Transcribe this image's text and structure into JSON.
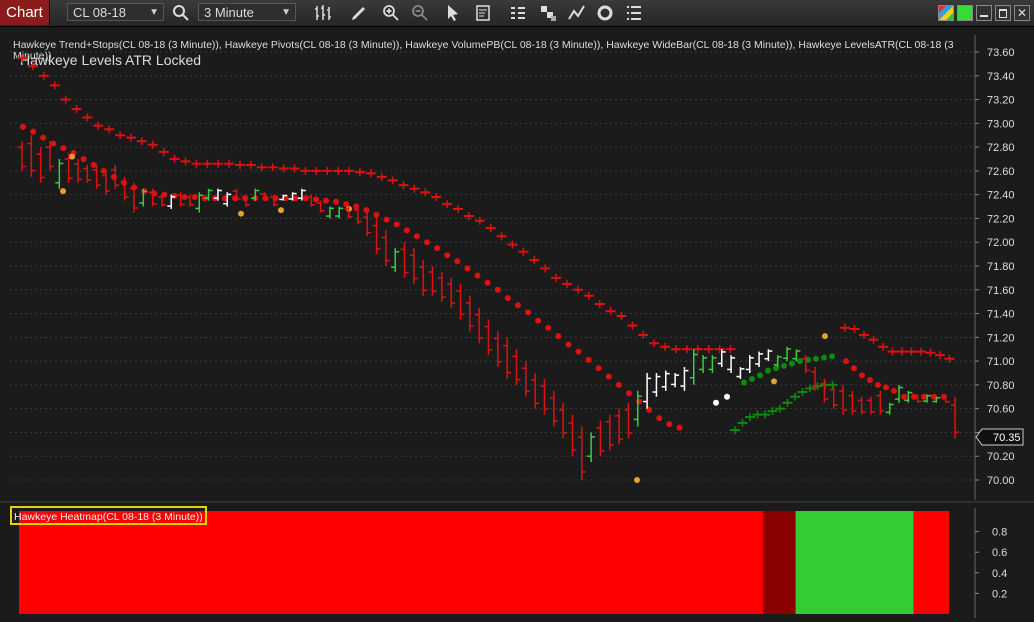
{
  "toolbar": {
    "chart_label": "Chart",
    "instrument": "CL 08-18",
    "interval": "3 Minute"
  },
  "colors": {
    "bear": "#e01010",
    "bull": "#3ccc3c",
    "neutral": "#ffffff",
    "pivot": "#e8a030",
    "stop_bull": "#0c8a0c",
    "heat_dark": "#8b0000"
  },
  "chart": {
    "indicators_line": "Hawkeye Trend+Stops(CL 08-18 (3 Minute)), Hawkeye Pivots(CL 08-18 (3 Minute)), Hawkeye VolumePB(CL 08-18 (3 Minute)), Hawkeye WideBar(CL 08-18 (3 Minute)), Hawkeye LevelsATR(CL 08-18 (3",
    "indicators_wrap": "Minute))",
    "levels_label": "Hawkeye Levels ATR Locked",
    "price_axis": [
      "73.60",
      "73.40",
      "73.20",
      "73.00",
      "72.80",
      "72.60",
      "72.40",
      "72.20",
      "72.00",
      "71.80",
      "71.60",
      "71.40",
      "71.20",
      "71.00",
      "70.80",
      "70.60",
      "70.40",
      "70.20",
      "70.00"
    ],
    "last_price": "70.35",
    "heatmap_label": "Hawkeye Heatmap(CL 08-18 (3 Minute))",
    "heatmap_axis": [
      "0.8",
      "0.6",
      "0.4",
      "0.2"
    ]
  },
  "chart_data": {
    "type": "ohlc",
    "price_range": [
      69.85,
      73.75
    ],
    "bars": [
      [
        72.85,
        72.6,
        "r"
      ],
      [
        72.9,
        72.55,
        "r"
      ],
      [
        72.8,
        72.5,
        "r"
      ],
      [
        72.85,
        72.6,
        "r"
      ],
      [
        72.7,
        72.45,
        "g"
      ],
      [
        72.75,
        72.5,
        "r"
      ],
      [
        72.7,
        72.5,
        "r"
      ],
      [
        72.65,
        72.5,
        "r"
      ],
      [
        72.65,
        72.45,
        "r"
      ],
      [
        72.6,
        72.4,
        "r"
      ],
      [
        72.65,
        72.45,
        "r"
      ],
      [
        72.55,
        72.35,
        "r"
      ],
      [
        72.5,
        72.25,
        "r"
      ],
      [
        72.45,
        72.3,
        "g"
      ],
      [
        72.45,
        72.3,
        "r"
      ],
      [
        72.4,
        72.3,
        "r"
      ],
      [
        72.4,
        72.28,
        "w"
      ],
      [
        72.42,
        72.3,
        "r"
      ],
      [
        72.4,
        72.3,
        "r"
      ],
      [
        72.42,
        72.25,
        "g"
      ],
      [
        72.45,
        72.35,
        "g"
      ],
      [
        72.45,
        72.35,
        "w"
      ],
      [
        72.42,
        72.3,
        "w"
      ],
      [
        72.45,
        72.35,
        "r"
      ],
      [
        72.4,
        72.3,
        "r"
      ],
      [
        72.45,
        72.35,
        "g"
      ],
      [
        72.42,
        72.35,
        "r"
      ],
      [
        72.4,
        72.3,
        "r"
      ],
      [
        72.4,
        72.35,
        "w"
      ],
      [
        72.42,
        72.35,
        "w"
      ],
      [
        72.45,
        72.35,
        "w"
      ],
      [
        72.4,
        72.3,
        "r"
      ],
      [
        72.35,
        72.25,
        "r"
      ],
      [
        72.3,
        72.2,
        "g"
      ],
      [
        72.3,
        72.2,
        "g"
      ],
      [
        72.3,
        72.2,
        "r"
      ],
      [
        72.3,
        72.15,
        "r"
      ],
      [
        72.25,
        72.05,
        "r"
      ],
      [
        72.2,
        71.9,
        "r"
      ],
      [
        72.1,
        71.8,
        "r"
      ],
      [
        71.95,
        71.75,
        "g"
      ],
      [
        72.0,
        71.7,
        "r"
      ],
      [
        71.95,
        71.65,
        "r"
      ],
      [
        71.85,
        71.55,
        "r"
      ],
      [
        71.8,
        71.55,
        "r"
      ],
      [
        71.75,
        71.5,
        "r"
      ],
      [
        71.7,
        71.45,
        "r"
      ],
      [
        71.65,
        71.35,
        "r"
      ],
      [
        71.55,
        71.25,
        "r"
      ],
      [
        71.45,
        71.15,
        "r"
      ],
      [
        71.35,
        71.05,
        "r"
      ],
      [
        71.25,
        70.95,
        "r"
      ],
      [
        71.2,
        70.85,
        "r"
      ],
      [
        71.1,
        70.8,
        "r"
      ],
      [
        71.0,
        70.7,
        "r"
      ],
      [
        70.9,
        70.6,
        "r"
      ],
      [
        70.85,
        70.55,
        "r"
      ],
      [
        70.75,
        70.45,
        "r"
      ],
      [
        70.65,
        70.35,
        "r"
      ],
      [
        70.55,
        70.2,
        "r"
      ],
      [
        70.45,
        70.0,
        "r"
      ],
      [
        70.4,
        70.15,
        "g"
      ],
      [
        70.5,
        70.2,
        "r"
      ],
      [
        70.55,
        70.25,
        "r"
      ],
      [
        70.6,
        70.3,
        "r"
      ],
      [
        70.65,
        70.35,
        "r"
      ],
      [
        70.75,
        70.45,
        "g"
      ],
      [
        70.9,
        70.6,
        "w"
      ],
      [
        70.9,
        70.7,
        "w"
      ],
      [
        70.92,
        70.75,
        "w"
      ],
      [
        70.9,
        70.78,
        "w"
      ],
      [
        70.95,
        70.75,
        "w"
      ],
      [
        71.1,
        70.8,
        "g"
      ],
      [
        71.05,
        70.9,
        "g"
      ],
      [
        71.05,
        70.9,
        "g"
      ],
      [
        71.1,
        70.95,
        "w"
      ],
      [
        71.05,
        70.9,
        "w"
      ],
      [
        70.95,
        70.85,
        "w"
      ],
      [
        71.05,
        70.9,
        "w"
      ],
      [
        71.08,
        70.95,
        "w"
      ],
      [
        71.1,
        71.0,
        "w"
      ],
      [
        71.05,
        70.95,
        "g"
      ],
      [
        71.12,
        71.0,
        "g"
      ],
      [
        71.1,
        71.0,
        "g"
      ],
      [
        71.05,
        70.9,
        "r"
      ],
      [
        70.95,
        70.75,
        "r"
      ],
      [
        70.85,
        70.65,
        "r"
      ],
      [
        70.8,
        70.6,
        "r"
      ],
      [
        70.8,
        70.55,
        "r"
      ],
      [
        70.75,
        70.55,
        "r"
      ],
      [
        70.7,
        70.55,
        "r"
      ],
      [
        70.7,
        70.55,
        "r"
      ],
      [
        70.75,
        70.55,
        "r"
      ],
      [
        70.65,
        70.55,
        "g"
      ],
      [
        70.8,
        70.65,
        "g"
      ],
      [
        70.75,
        70.65,
        "g"
      ],
      [
        70.72,
        70.65,
        "r"
      ],
      [
        70.72,
        70.65,
        "g"
      ],
      [
        70.7,
        70.65,
        "g"
      ],
      [
        70.7,
        70.65,
        "r"
      ],
      [
        70.7,
        70.35,
        "r"
      ]
    ],
    "trend_dots_bear_y": [
      72.97,
      72.93,
      72.88,
      72.83,
      72.79,
      72.75,
      72.7,
      72.65,
      72.6,
      72.55,
      72.5,
      72.46,
      72.43,
      72.41,
      72.4,
      72.39,
      72.38,
      72.38,
      72.37,
      72.37,
      72.37,
      72.37,
      72.37,
      72.37,
      72.37,
      72.37,
      72.37,
      72.37,
      72.37,
      72.36,
      72.35,
      72.34,
      72.32,
      72.3,
      72.27,
      72.23,
      72.19,
      72.15,
      72.1,
      72.05,
      72.0,
      71.95,
      71.89,
      71.84,
      71.78,
      71.72,
      71.66,
      71.6,
      71.53,
      71.47,
      71.41,
      71.34,
      71.28,
      71.21,
      71.14,
      71.08,
      71.01,
      70.94,
      70.87,
      70.8,
      70.73,
      70.66,
      70.59,
      70.52,
      70.47,
      70.44
    ],
    "stop_line_bear_y": [
      73.55,
      73.48,
      73.4,
      73.32,
      73.2,
      73.12,
      73.05,
      72.98,
      72.95,
      72.9,
      72.88,
      72.85,
      72.82,
      72.76,
      72.7,
      72.68,
      72.66,
      72.66,
      72.66,
      72.66,
      72.65,
      72.65,
      72.63,
      72.63,
      72.62,
      72.62,
      72.6,
      72.6,
      72.6,
      72.6,
      72.6,
      72.59,
      72.58,
      72.55,
      72.52,
      72.48,
      72.45,
      72.42,
      72.38,
      72.32,
      72.28,
      72.22,
      72.18,
      72.12,
      72.05,
      71.98,
      71.92,
      71.85,
      71.78,
      71.7,
      71.65,
      71.6,
      71.55,
      71.48,
      71.42,
      71.38,
      71.3,
      71.22,
      71.15,
      71.12,
      71.1,
      71.1,
      71.1,
      71.1,
      71.1,
      71.1
    ],
    "heatmap": [
      {
        "value": 1.0,
        "color": "#ff0000",
        "start": 0,
        "end": 0.8
      },
      {
        "value": 1.0,
        "color": "#8b0000",
        "start": 0.8,
        "end": 0.835
      },
      {
        "value": 1.0,
        "color": "#33cc33",
        "start": 0.835,
        "end": 0.962
      },
      {
        "value": 1.0,
        "color": "#ff0000",
        "start": 0.962,
        "end": 1.0
      }
    ]
  }
}
